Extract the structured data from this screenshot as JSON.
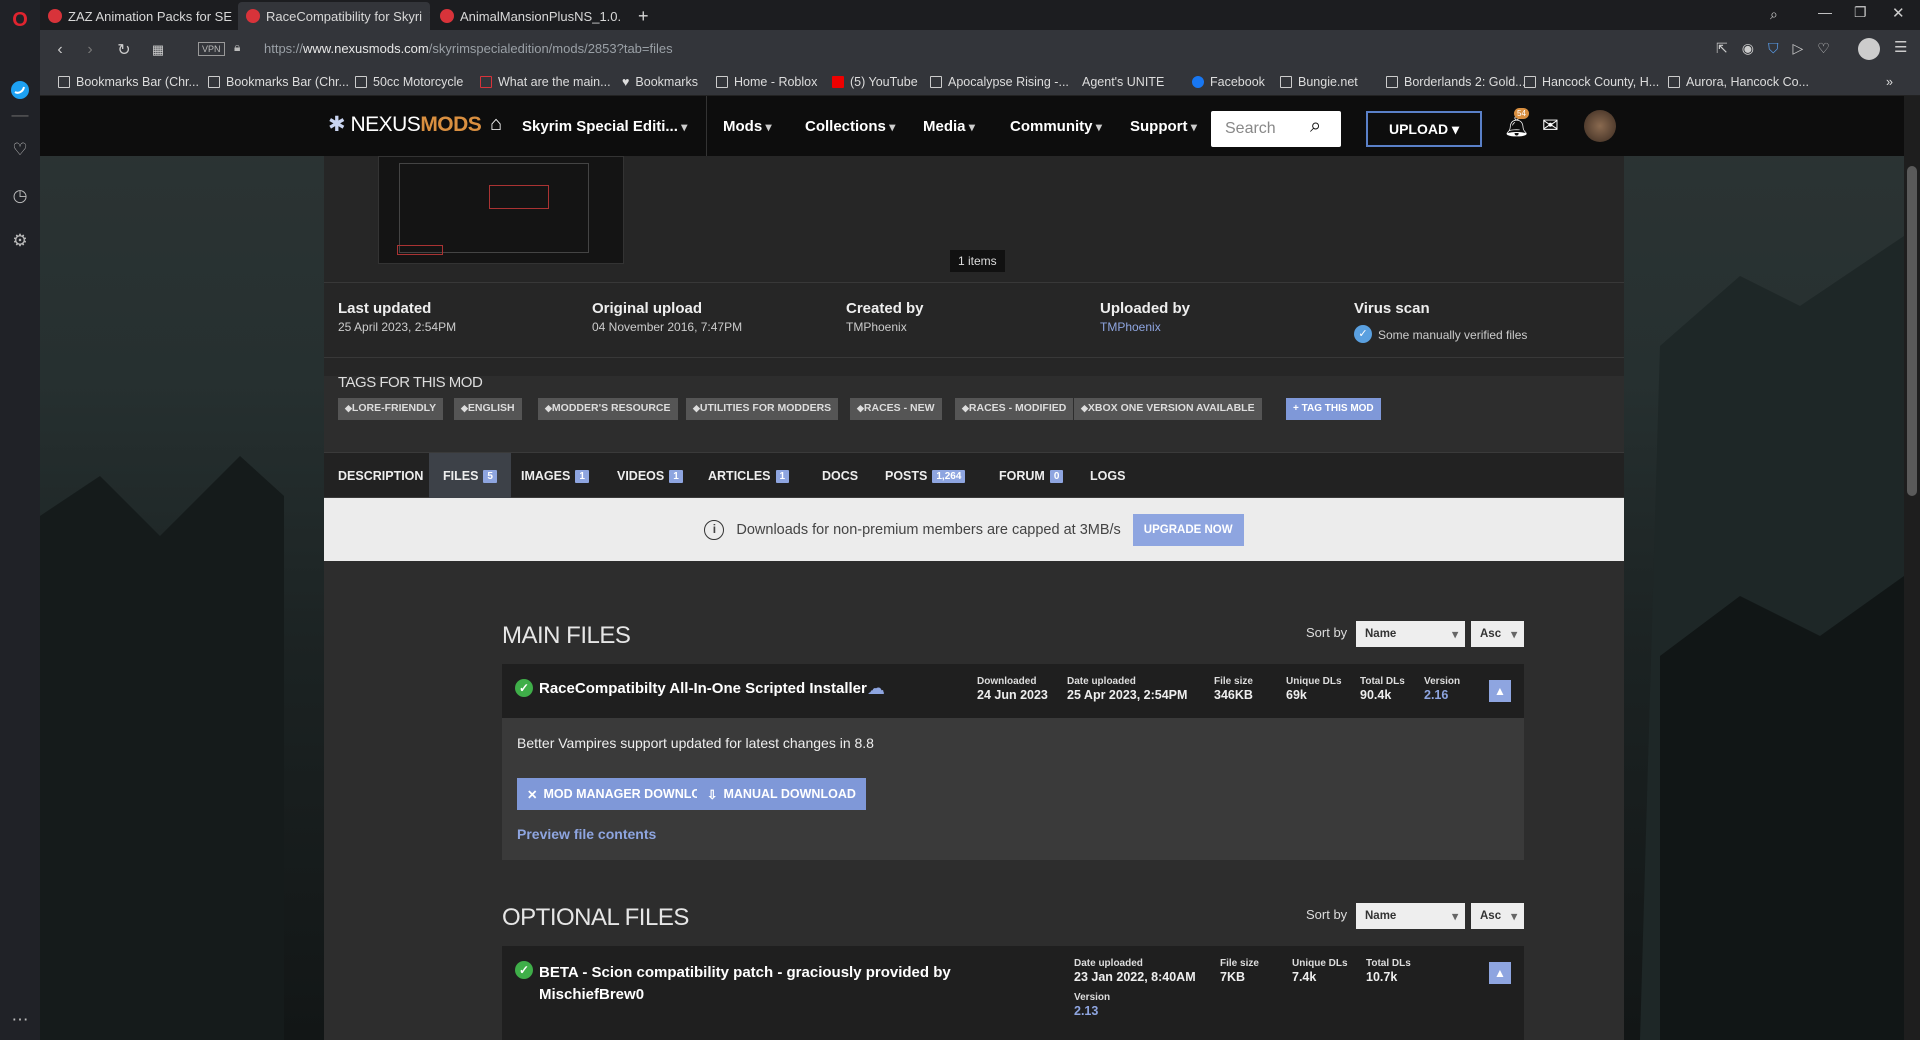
{
  "browser": {
    "tabs": [
      {
        "label": "ZAZ Animation Packs for SE"
      },
      {
        "label": "RaceCompatibility for Skyri"
      },
      {
        "label": "AnimalMansionPlusNS_1.0."
      }
    ],
    "new_tab": "+",
    "url_prefix": "https://",
    "url_domain": "www.nexusmods.com",
    "url_path": "/skyrimspecialedition/mods/2853?tab=files",
    "vpn_label": "VPN",
    "bookmarks": [
      "Bookmarks Bar (Chr...",
      "Bookmarks Bar (Chr...",
      "50cc Motorcycle",
      "What are the main...",
      "Bookmarks",
      "Home - Roblox",
      "(5) YouTube",
      "Apocalypse Rising -...",
      "Agent's UNITE",
      "Facebook",
      "Bungie.net",
      "Borderlands 2: Gold...",
      "Hancock County, H...",
      "Aurora, Hancock Co..."
    ],
    "more_bookmarks": "»"
  },
  "nexus": {
    "logo_a": "NEXUS",
    "logo_b": "MODS",
    "game": "Skyrim Special Editi...",
    "menu": [
      "Mods",
      "Collections",
      "Media",
      "Community",
      "Support"
    ],
    "search_placeholder": "Search",
    "upload": "UPLOAD",
    "notif_count": "54"
  },
  "gallery": {
    "items_label": "1 items"
  },
  "meta": [
    {
      "label": "Last updated",
      "value": "25 April 2023,  2:54PM"
    },
    {
      "label": "Original upload",
      "value": "04 November 2016,  7:47PM"
    },
    {
      "label": "Created by",
      "value": "TMPhoenix"
    },
    {
      "label": "Uploaded by",
      "value": "TMPhoenix"
    },
    {
      "label": "Virus scan",
      "value": "Some manually verified files"
    }
  ],
  "tags": {
    "heading": "TAGS FOR THIS MOD",
    "items": [
      "LORE-FRIENDLY",
      "ENGLISH",
      "MODDER'S RESOURCE",
      "UTILITIES FOR MODDERS",
      "RACES - NEW",
      "RACES - MODIFIED",
      "XBOX ONE VERSION AVAILABLE"
    ],
    "add": "TAG THIS MOD"
  },
  "mod_tabs": [
    {
      "label": "DESCRIPTION",
      "count": ""
    },
    {
      "label": "FILES",
      "count": "5"
    },
    {
      "label": "IMAGES",
      "count": "1"
    },
    {
      "label": "VIDEOS",
      "count": "1"
    },
    {
      "label": "ARTICLES",
      "count": "1"
    },
    {
      "label": "DOCS",
      "count": ""
    },
    {
      "label": "POSTS",
      "count": "1,264"
    },
    {
      "label": "FORUM",
      "count": "0"
    },
    {
      "label": "LOGS",
      "count": ""
    }
  ],
  "premium": {
    "text": "Downloads for non-premium members are capped at 3MB/s",
    "button": "UPGRADE NOW"
  },
  "main_files": {
    "heading": "MAIN FILES",
    "sort_label": "Sort by",
    "sort_field": "Name",
    "sort_order": "Asc",
    "file": {
      "title": "RaceCompatibilty All-In-One Scripted Installer",
      "stats": [
        {
          "label": "Downloaded",
          "value": "24 Jun 2023"
        },
        {
          "label": "Date uploaded",
          "value": "25 Apr 2023, 2:54PM"
        },
        {
          "label": "File size",
          "value": "346KB"
        },
        {
          "label": "Unique DLs",
          "value": "69k"
        },
        {
          "label": "Total DLs",
          "value": "90.4k"
        },
        {
          "label": "Version",
          "value": "2.16"
        }
      ],
      "description": "Better Vampires support updated for latest changes in 8.8",
      "mod_manager_btn": "MOD MANAGER DOWNLOAD",
      "manual_btn": "MANUAL DOWNLOAD",
      "preview": "Preview file contents"
    }
  },
  "optional_files": {
    "heading": "OPTIONAL FILES",
    "sort_label": "Sort by",
    "sort_field": "Name",
    "sort_order": "Asc",
    "file": {
      "title_line1": "BETA - Scion compatibility patch - graciously provided by",
      "title_line2": "MischiefBrew0",
      "stats": [
        {
          "label": "Date uploaded",
          "value": "23 Jan 2022, 8:40AM"
        },
        {
          "label": "File size",
          "value": "7KB"
        },
        {
          "label": "Unique DLs",
          "value": "7.4k"
        },
        {
          "label": "Total DLs",
          "value": "10.7k"
        },
        {
          "label": "Version",
          "value": "2.13"
        }
      ]
    }
  },
  "colors": {
    "accent": "#8ea5e0",
    "ok": "#3fae49",
    "opera": "#d8333a"
  }
}
